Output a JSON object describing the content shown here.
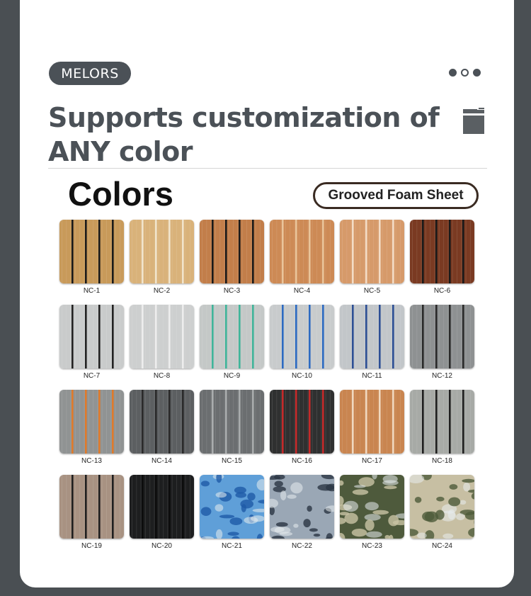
{
  "brand": {
    "name": "MELORS"
  },
  "pager": {
    "dots": [
      "filled",
      "empty",
      "filled"
    ]
  },
  "headline": {
    "line1": "Supports customization of",
    "line2": "ANY color"
  },
  "section": {
    "title": "Colors",
    "product": "Grooved Foam Sheet"
  },
  "swatches": [
    {
      "code": "NC-1",
      "base": "#c89a5a",
      "stripe": "#1a1a1a",
      "pattern": "grooved"
    },
    {
      "code": "NC-2",
      "base": "#d9b27a",
      "stripe": "#f1e4cc",
      "pattern": "grooved"
    },
    {
      "code": "NC-3",
      "base": "#c27e4a",
      "stripe": "#1a1a1a",
      "pattern": "grooved"
    },
    {
      "code": "NC-4",
      "base": "#cd8a55",
      "stripe": "#e9c49a",
      "pattern": "grooved"
    },
    {
      "code": "NC-5",
      "base": "#d69a6a",
      "stripe": "#f3dcc6",
      "pattern": "grooved"
    },
    {
      "code": "NC-6",
      "base": "#7a3a22",
      "stripe": "#1a1a1a",
      "pattern": "grooved"
    },
    {
      "code": "NC-7",
      "base": "#c9cbcb",
      "stripe": "#222222",
      "pattern": "grooved"
    },
    {
      "code": "NC-8",
      "base": "#cdcfcf",
      "stripe": "#ededed",
      "pattern": "grooved"
    },
    {
      "code": "NC-9",
      "base": "#c4c8c7",
      "stripe": "#3fb59a",
      "pattern": "grooved"
    },
    {
      "code": "NC-10",
      "base": "#c8cbcc",
      "stripe": "#2d6bc2",
      "pattern": "grooved"
    },
    {
      "code": "NC-11",
      "base": "#c2c6c9",
      "stripe": "#2d4f95",
      "pattern": "grooved"
    },
    {
      "code": "NC-12",
      "base": "#8e9192",
      "stripe": "#2a2a2a",
      "pattern": "grooved"
    },
    {
      "code": "NC-13",
      "base": "#909393",
      "stripe": "#e07a2a",
      "pattern": "grooved"
    },
    {
      "code": "NC-14",
      "base": "#5c5f61",
      "stripe": "#2a2a2a",
      "pattern": "grooved"
    },
    {
      "code": "NC-15",
      "base": "#6b6e70",
      "stripe": "#a9acad",
      "pattern": "grooved"
    },
    {
      "code": "NC-16",
      "base": "#2f3030",
      "stripe": "#c42a2a",
      "pattern": "grooved"
    },
    {
      "code": "NC-17",
      "base": "#c98550",
      "stripe": "#f0d8bf",
      "pattern": "grooved"
    },
    {
      "code": "NC-18",
      "base": "#a7aaa6",
      "stripe": "#1f1f1f",
      "pattern": "grooved"
    },
    {
      "code": "NC-19",
      "base": "#a89282",
      "stripe": "#1f1f1f",
      "pattern": "grooved"
    },
    {
      "code": "NC-20",
      "base": "#1d1e1f",
      "stripe": "#0c0c0c",
      "pattern": "grooved"
    },
    {
      "code": "NC-21",
      "base": "#5f9fd8",
      "stripe": "#1e5aa8",
      "pattern": "camo"
    },
    {
      "code": "NC-22",
      "base": "#9aa7b5",
      "stripe": "#2a3644",
      "pattern": "camo"
    },
    {
      "code": "NC-23",
      "base": "#4e5a3c",
      "stripe": "#c9c3a4",
      "pattern": "camo"
    },
    {
      "code": "NC-24",
      "base": "#c7bfa3",
      "stripe": "#4e5b3a",
      "pattern": "camo"
    }
  ]
}
